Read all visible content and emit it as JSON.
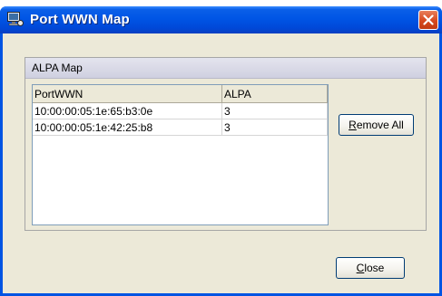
{
  "window": {
    "title": "Port WWN Map",
    "icon": "app-window-icon",
    "close_icon": "close-icon"
  },
  "group": {
    "title": "ALPA Map"
  },
  "table": {
    "columns": [
      "PortWWN",
      "ALPA"
    ],
    "rows": [
      [
        "10:00:00:05:1e:65:b3:0e",
        "3"
      ],
      [
        "10:00:00:05:1e:42:25:b8",
        "3"
      ]
    ]
  },
  "buttons": {
    "remove_all_mnemonic": "R",
    "remove_all_rest": "emove All",
    "close_mnemonic": "C",
    "close_rest": "lose"
  },
  "colors": {
    "titlebar": "#0055e5",
    "window_bg": "#ece9d8",
    "close_button": "#d6491f"
  }
}
